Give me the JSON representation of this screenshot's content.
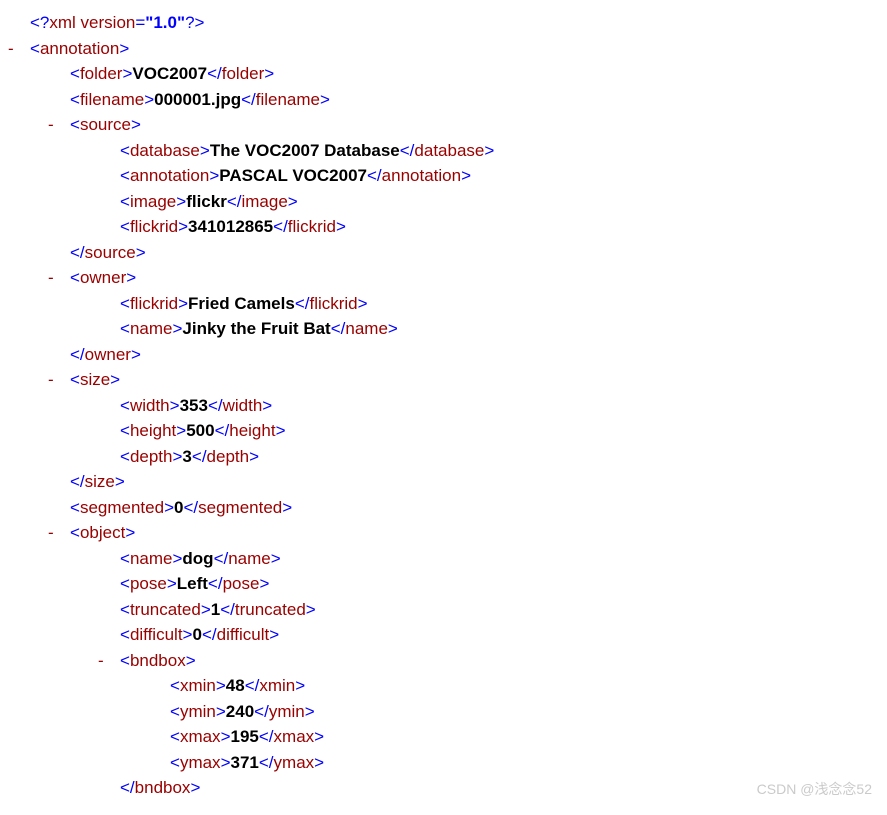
{
  "xmlDecl": "<?xml version=\"1.0\"?>",
  "annotation": {
    "folder": "VOC2007",
    "filename": "000001.jpg",
    "source": {
      "database": "The VOC2007 Database",
      "annotation": "PASCAL VOC2007",
      "image": "flickr",
      "flickrid": "341012865"
    },
    "owner": {
      "flickrid": "Fried Camels",
      "name": "Jinky the Fruit Bat"
    },
    "size": {
      "width": "353",
      "height": "500",
      "depth": "3"
    },
    "segmented": "0",
    "object": {
      "name": "dog",
      "pose": "Left",
      "truncated": "1",
      "difficult": "0",
      "bndbox": {
        "xmin": "48",
        "ymin": "240",
        "xmax": "195",
        "ymax": "371"
      }
    }
  },
  "watermark": "CSDN @浅念念52"
}
